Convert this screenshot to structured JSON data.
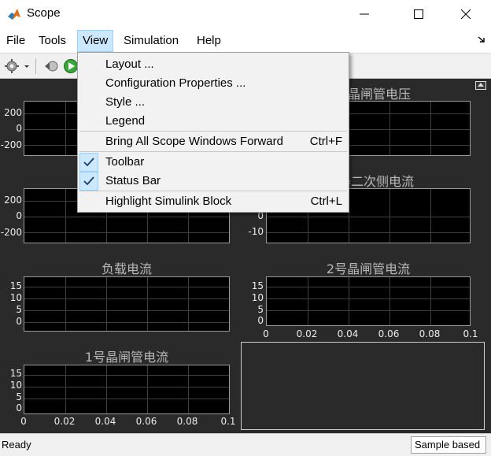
{
  "window": {
    "title": "Scope",
    "icon": "matlab-icon"
  },
  "menubar": {
    "items": [
      "File",
      "Tools",
      "View",
      "Simulation",
      "Help"
    ],
    "active": "View"
  },
  "toolbar": {
    "icons": [
      "settings-gear-icon",
      "dropdown-arrow-icon",
      "step-back-icon",
      "run-icon"
    ]
  },
  "view_menu": {
    "layout": "Layout ...",
    "configuration_properties": "Configuration Properties ...",
    "style": "Style ...",
    "legend": "Legend",
    "bring_forward": "Bring All Scope Windows Forward",
    "bring_forward_shortcut": "Ctrl+F",
    "toolbar": "Toolbar",
    "toolbar_checked": true,
    "status_bar": "Status Bar",
    "status_bar_checked": true,
    "highlight_block": "Highlight Simulink Block",
    "highlight_block_shortcut": "Ctrl+L"
  },
  "axes": {
    "a1": {
      "title_partial": "",
      "yticks": [
        "200",
        "0",
        "-200"
      ]
    },
    "a2": {
      "title_partial": "晶闸管电压",
      "yticks": []
    },
    "a3": {
      "title_partial": "",
      "yticks": [
        "200",
        "0",
        "-200"
      ]
    },
    "a4": {
      "title_partial": "器二次侧电流",
      "yticks": [
        "0",
        "-10"
      ]
    },
    "a5": {
      "title": "负载电流",
      "yticks": [
        "15",
        "10",
        "5",
        "0"
      ]
    },
    "a6": {
      "title": "2号晶闸管电流",
      "yticks": [
        "15",
        "10",
        "5",
        "0"
      ],
      "xticks": [
        "0",
        "0.02",
        "0.04",
        "0.06",
        "0.08",
        "0.1"
      ]
    },
    "a7": {
      "title": "1号晶闸管电流",
      "yticks": [
        "15",
        "10",
        "5",
        "0"
      ],
      "xticks": [
        "0",
        "0.02",
        "0.04",
        "0.06",
        "0.08",
        "0.1"
      ]
    }
  },
  "colors": {
    "plot_background": "#2a2a2a",
    "axes_background": "#000000",
    "menu_highlight": "#cce8ff"
  },
  "statusbar": {
    "status": "Ready",
    "mode": "Sample based"
  }
}
